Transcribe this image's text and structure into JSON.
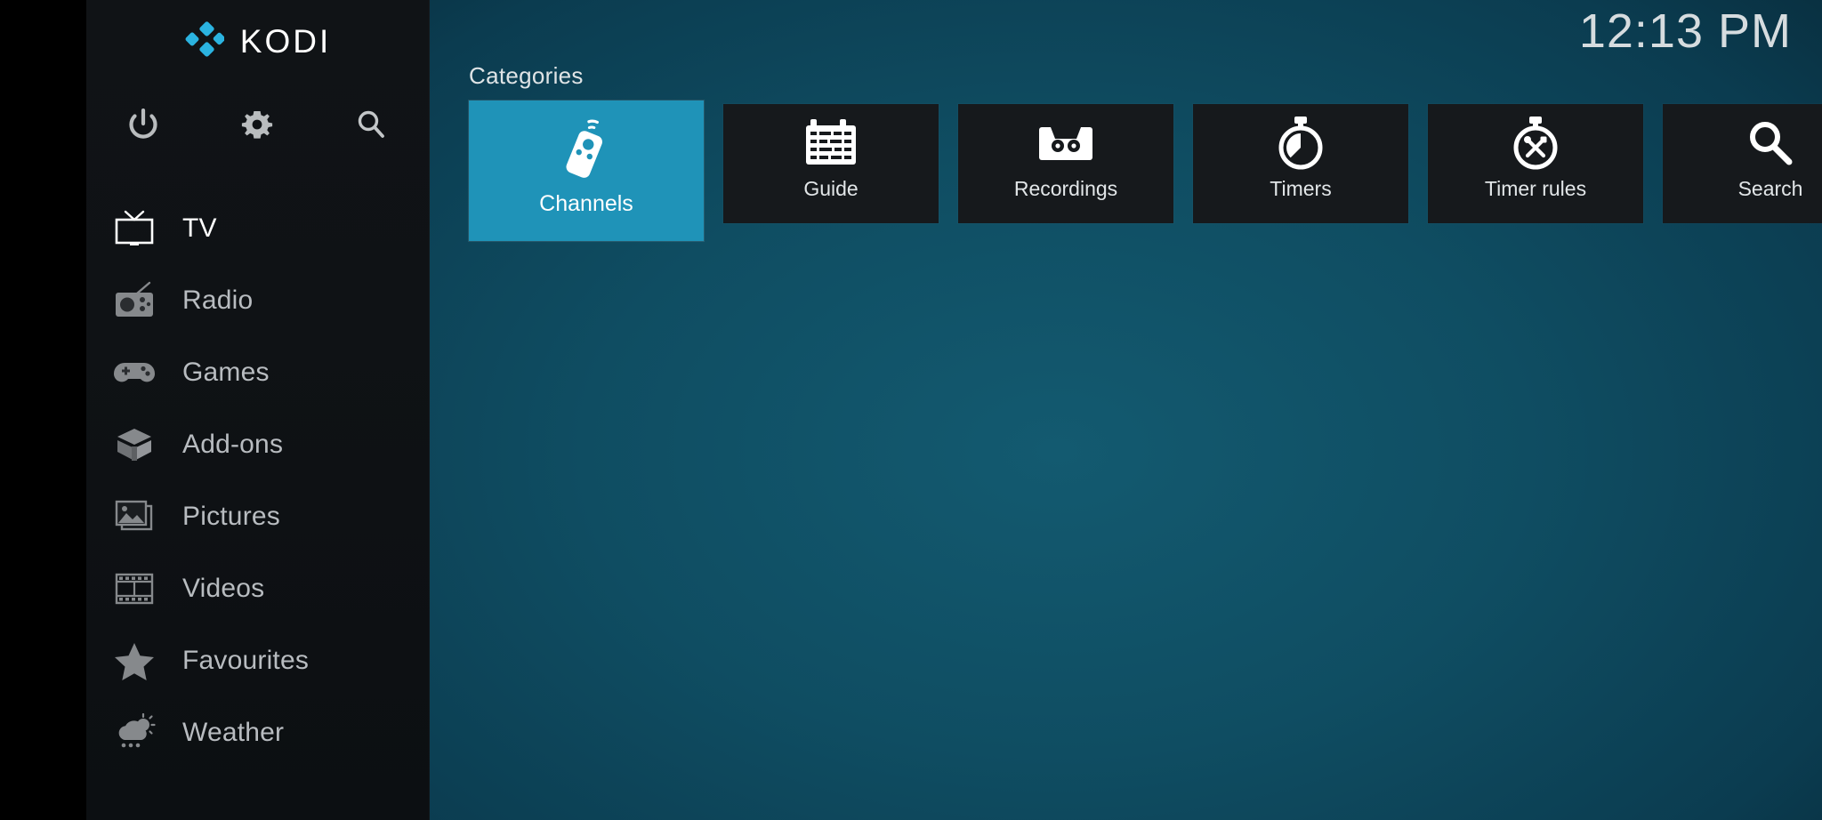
{
  "app": {
    "name": "KODI",
    "logo_color": "#2bb3e0",
    "accent_color": "#1f93b8",
    "clock": "12:13 PM"
  },
  "sidebar": {
    "quick_actions": [
      {
        "name": "power-icon",
        "label": "Power"
      },
      {
        "name": "gear-icon",
        "label": "Settings"
      },
      {
        "name": "search-icon",
        "label": "Search"
      }
    ],
    "items": [
      {
        "label": "TV",
        "icon": "tv-icon",
        "active": true
      },
      {
        "label": "Radio",
        "icon": "radio-icon",
        "active": false
      },
      {
        "label": "Games",
        "icon": "gamepad-icon",
        "active": false
      },
      {
        "label": "Add-ons",
        "icon": "addons-box-icon",
        "active": false
      },
      {
        "label": "Pictures",
        "icon": "pictures-icon",
        "active": false
      },
      {
        "label": "Videos",
        "icon": "film-strip-icon",
        "active": false
      },
      {
        "label": "Favourites",
        "icon": "star-icon",
        "active": false
      },
      {
        "label": "Weather",
        "icon": "weather-icon",
        "active": false
      }
    ]
  },
  "main": {
    "section_label": "Categories",
    "tiles": [
      {
        "label": "Channels",
        "icon": "remote-control-icon",
        "selected": true
      },
      {
        "label": "Guide",
        "icon": "calendar-grid-icon",
        "selected": false
      },
      {
        "label": "Recordings",
        "icon": "cassette-tape-icon",
        "selected": false
      },
      {
        "label": "Timers",
        "icon": "stopwatch-icon",
        "selected": false
      },
      {
        "label": "Timer rules",
        "icon": "stopwatch-tools-icon",
        "selected": false
      },
      {
        "label": "Search",
        "icon": "magnifier-icon",
        "selected": false
      }
    ]
  }
}
